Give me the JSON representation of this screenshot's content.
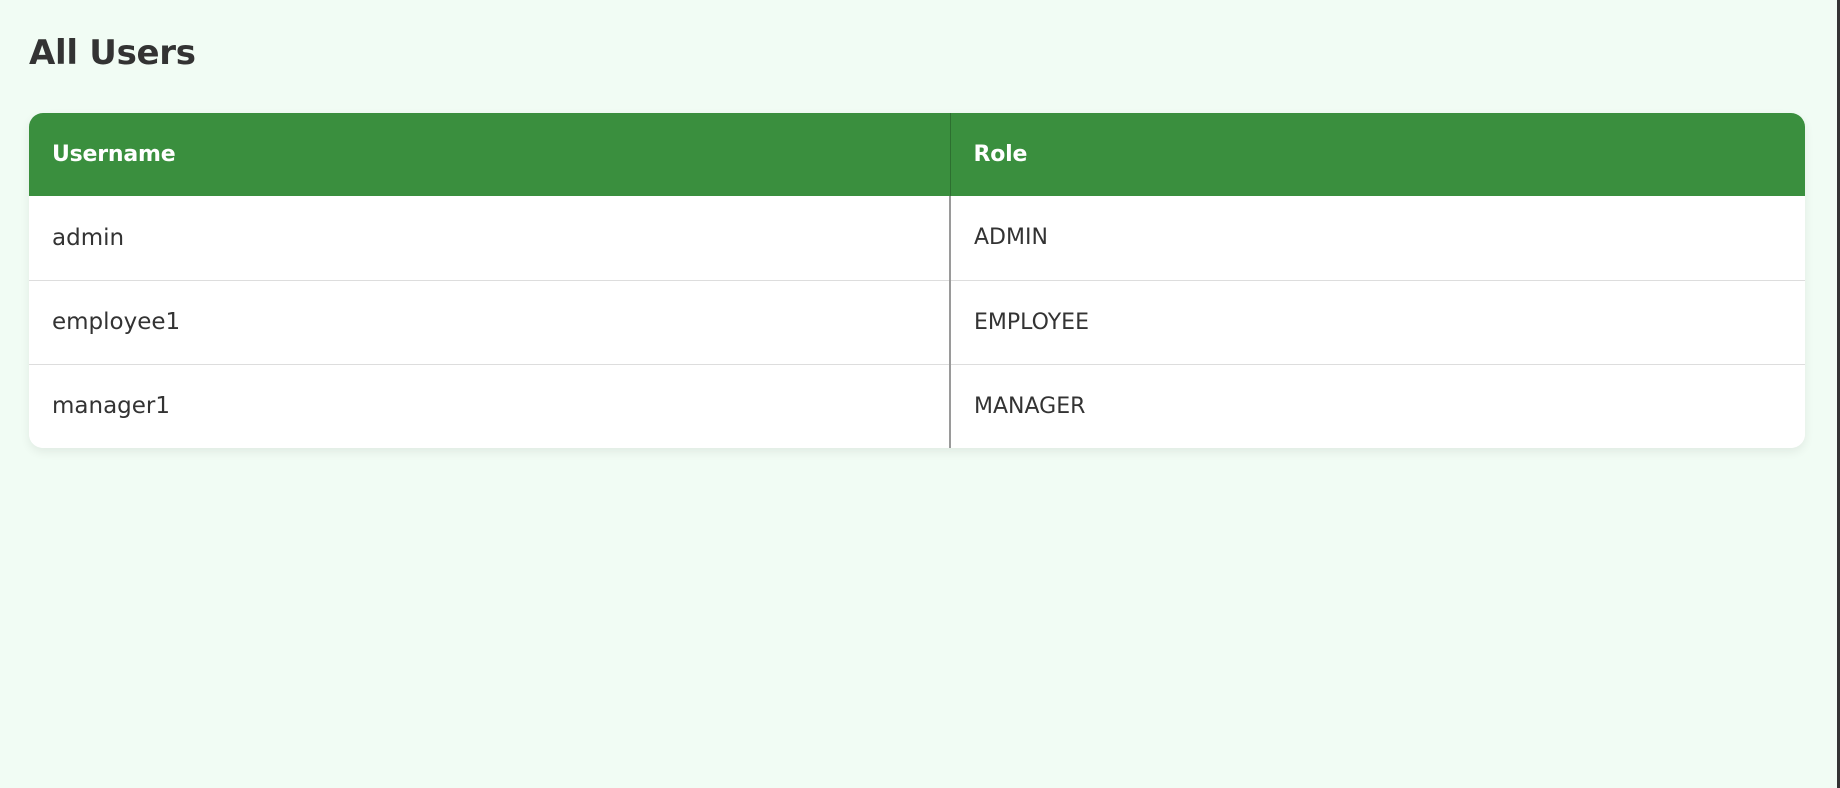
{
  "page": {
    "title": "All Users",
    "colors": {
      "background": "#f1fcf4",
      "header_green": "#3a8f3e",
      "text": "#333333"
    }
  },
  "table": {
    "headers": [
      "Username",
      "Role"
    ],
    "rows": [
      [
        "admin",
        "ADMIN"
      ],
      [
        "employee1",
        "EMPLOYEE"
      ],
      [
        "manager1",
        "MANAGER"
      ]
    ]
  }
}
